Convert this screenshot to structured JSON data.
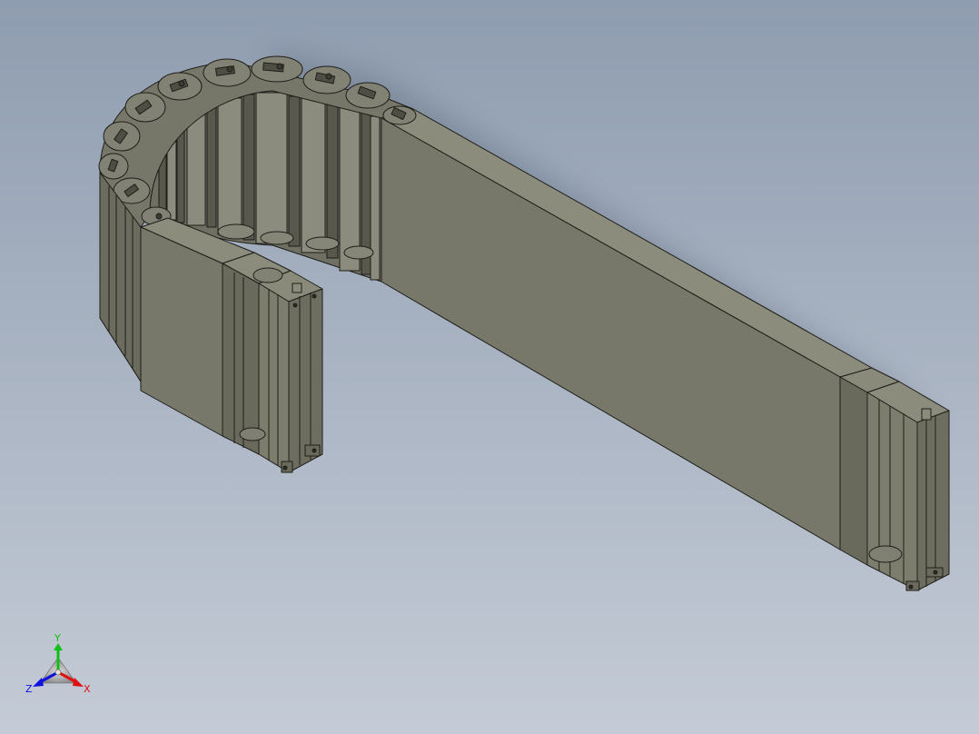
{
  "viewport": {
    "background_top": "#8f9db0",
    "background_bottom": "#c4cbd6",
    "model_face_color": "#7a7a6a",
    "model_top_color": "#8c8c7c",
    "model_dark_color": "#5e5e52",
    "edge_color": "#1e1e1a",
    "shadow_color": "#5d6a7c"
  },
  "model": {
    "name": "cable-drag-chain"
  },
  "triad": {
    "x_label": "X",
    "y_label": "Y",
    "z_label": "Z",
    "x_color": "#e01010",
    "y_color": "#10c010",
    "z_color": "#1010e0"
  }
}
